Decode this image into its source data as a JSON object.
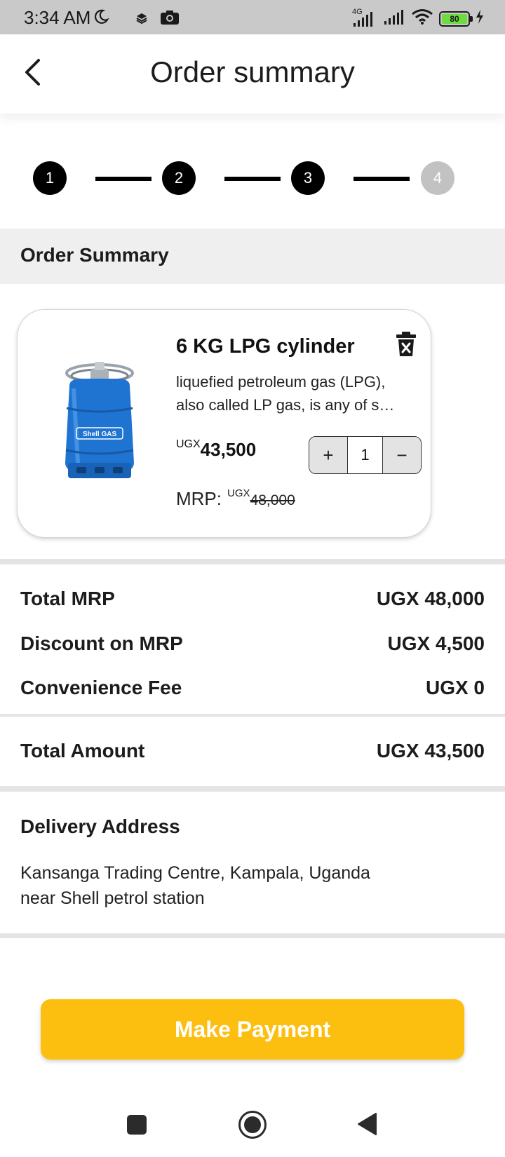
{
  "status_bar": {
    "time": "3:34 AM",
    "network_type": "4G",
    "battery_level": "80",
    "icons": [
      "moon-icon",
      "layers-icon",
      "camera-icon",
      "signal-icon",
      "wifi-icon",
      "battery-icon",
      "charging-icon"
    ]
  },
  "header": {
    "title": "Order summary",
    "back_icon": "chevron-left-icon"
  },
  "stepper": {
    "steps": [
      {
        "label": "1",
        "state": "done"
      },
      {
        "label": "2",
        "state": "done"
      },
      {
        "label": "3",
        "state": "current"
      },
      {
        "label": "4",
        "state": "pending"
      }
    ]
  },
  "section": {
    "title": "Order Summary"
  },
  "product": {
    "name": "6 KG LPG cylinder",
    "description_line1": "liquefied petroleum gas (LPG),",
    "description_line2": "also called LP gas, is any of s…",
    "currency": "UGX",
    "price": "43,500",
    "quantity": "1",
    "plus_label": "+",
    "minus_label": "−",
    "mrp_label": "MRP:",
    "mrp_currency": "UGX",
    "mrp_value": "48,000",
    "image_text": "Shell GAS",
    "delete_icon": "trash-icon"
  },
  "totals": {
    "rows": [
      {
        "label": "Total MRP",
        "value": "UGX 48,000"
      },
      {
        "label": "Discount on MRP",
        "value": "UGX 4,500"
      },
      {
        "label": "Convenience Fee",
        "value": "UGX 0"
      }
    ],
    "total_label": "Total Amount",
    "total_value": "UGX 43,500"
  },
  "address": {
    "title": "Delivery Address",
    "line1": "Kansanga Trading Centre, Kampala, Uganda",
    "line2": "near Shell petrol station"
  },
  "actions": {
    "make_payment": "Make Payment"
  },
  "colors": {
    "accent": "#fdbf0f",
    "step_active": "#000000",
    "step_inactive": "#c2c2c2"
  }
}
